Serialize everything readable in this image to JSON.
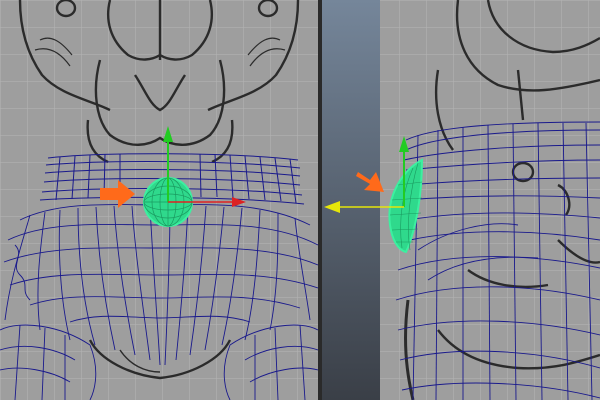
{
  "scene": {
    "viewport_background": "#9e9e9e",
    "grid_color": "#b8b8b8",
    "sketch_color": "#2b2b2b",
    "wireframe_color": "#1a1a8c",
    "selection_color": "#3cf0a0",
    "arrow_color": "#ff6a1a"
  },
  "viewports": [
    {
      "id": "front",
      "name": "front-viewport",
      "manipulator": {
        "type": "move-tool",
        "axes": [
          "y-axis",
          "x-axis",
          "z-center"
        ],
        "colors": {
          "y": "#22cc22",
          "x": "#dd2222",
          "center": "#3cf0a0"
        }
      },
      "selected_object": "sphere-wireframe",
      "annotation": "orange-arrow"
    },
    {
      "id": "side",
      "name": "side-viewport",
      "manipulator": {
        "type": "move-tool",
        "axes": [
          "y-axis",
          "z-axis"
        ],
        "colors": {
          "y": "#22cc22",
          "z": "#e6e60a"
        }
      },
      "selected_object": "half-sphere-wireframe",
      "annotation": "orange-arrow"
    }
  ]
}
